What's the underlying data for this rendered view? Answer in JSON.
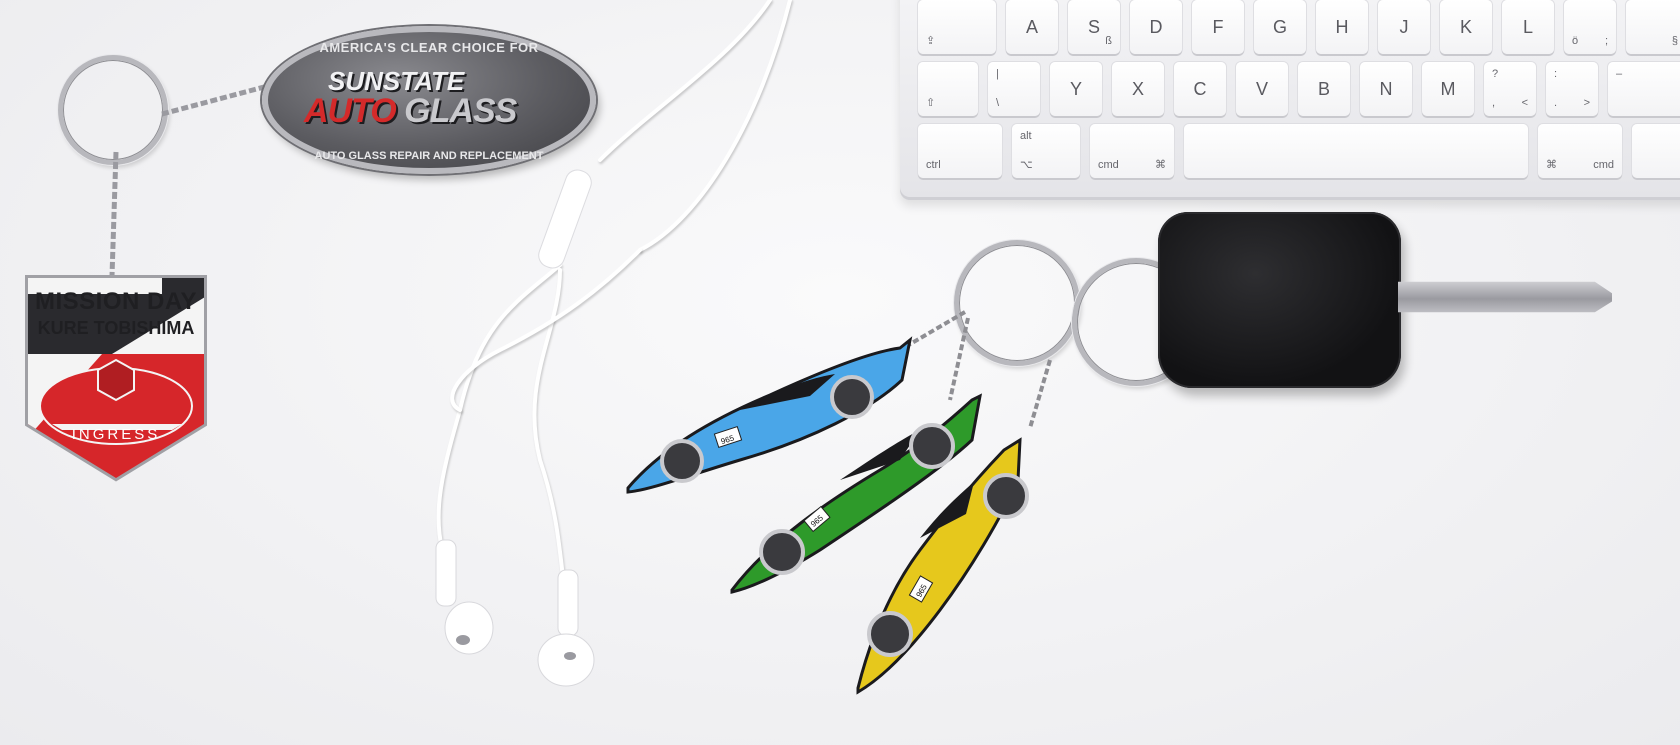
{
  "keyboard": {
    "row1": [
      "A",
      "S",
      "D",
      "F",
      "G",
      "H",
      "J",
      "K",
      "L",
      "ö",
      "§"
    ],
    "row2": [
      "Y",
      "X",
      "C",
      "V",
      "B",
      "N",
      "M",
      "?",
      ":",
      "–"
    ],
    "row1_sub": {
      "s": "ß",
      "semicolon": ";"
    },
    "row2_sub": {
      "lt": "<",
      "gt": ">",
      "comma": ",",
      "dot": ".",
      "pipe": "|",
      "backslash": "\\"
    },
    "mod_ctrl": "ctrl",
    "mod_alt": "alt",
    "mod_alt_symbol": "⌥",
    "mod_cmd": "cmd",
    "mod_cmd_symbol": "⌘",
    "shift_symbol": "⇧",
    "caps_symbol": "⇪"
  },
  "sunstate_tag": {
    "line1": "AMERICA'S CLEAR CHOICE FOR",
    "brand_top": "SUNSTATE",
    "brand_red": "AUTO",
    "brand_grey": "GLASS",
    "line2": "AUTO GLASS REPAIR AND REPLACEMENT"
  },
  "mission_tag": {
    "line1": "MISSION DAY",
    "line2": "KURE TOBISHIMA",
    "line3": "INGRESS"
  },
  "car_tags": {
    "plate": "965",
    "colors": {
      "blue": "#4aa6e8",
      "green": "#2e9a2a",
      "yellow": "#e6c81c"
    }
  }
}
